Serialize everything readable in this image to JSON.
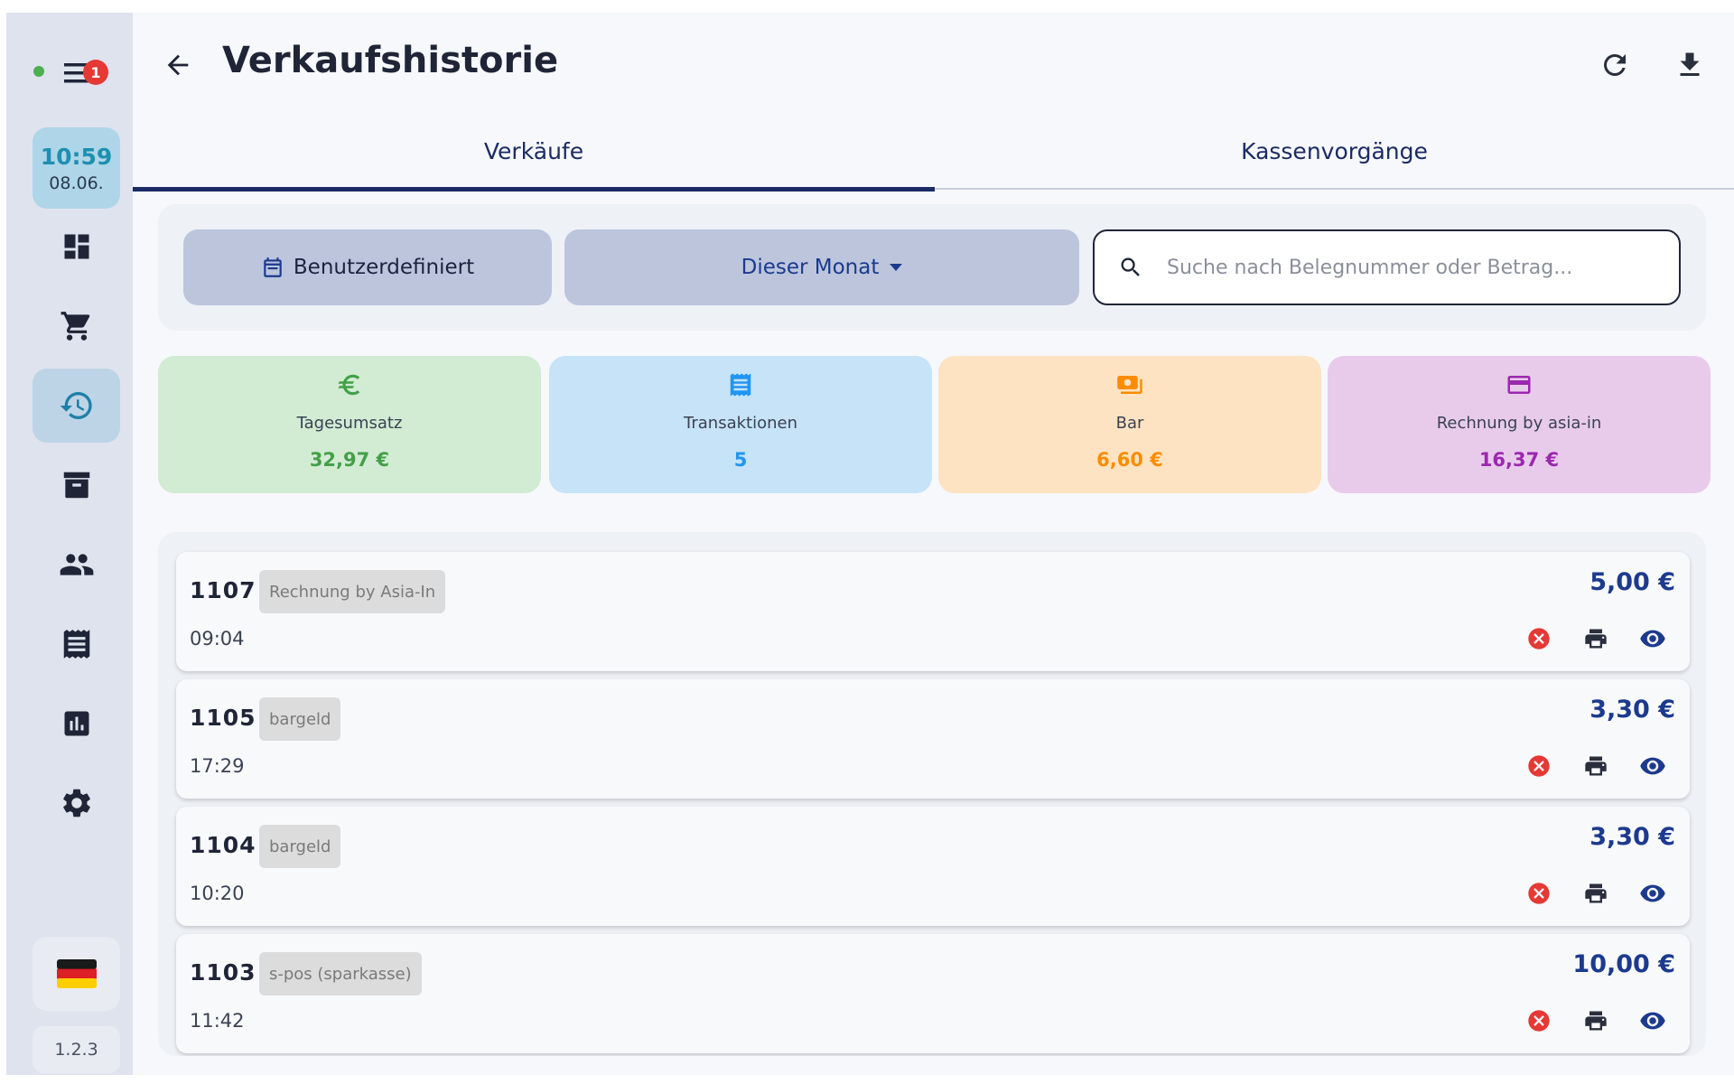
{
  "sidebar": {
    "notification_count": "1",
    "clock": {
      "time": "10:59",
      "date": "08.06."
    },
    "nav_items": [
      {
        "icon": "dashboard-icon"
      },
      {
        "icon": "cart-icon"
      },
      {
        "icon": "history-icon",
        "active": true
      },
      {
        "icon": "archive-icon"
      },
      {
        "icon": "users-icon"
      },
      {
        "icon": "receipt-icon"
      },
      {
        "icon": "chart-icon"
      },
      {
        "icon": "gear-icon"
      }
    ],
    "language_icon": "german-flag-icon",
    "version": "1.2.3"
  },
  "header": {
    "title": "Verkaufshistorie"
  },
  "tabs": [
    {
      "label": "Verkäufe",
      "active": true
    },
    {
      "label": "Kassenvorgänge",
      "active": false
    }
  ],
  "filters": {
    "custom_label": "Benutzerdefiniert",
    "period_label": "Dieser Monat",
    "search_placeholder": "Suche nach Belegnummer oder Betrag..."
  },
  "stats": [
    {
      "label": "Tagesumsatz",
      "value": "32,97 €",
      "color": "#43a047",
      "bg": "#d2ebd3",
      "icon": "euro-icon"
    },
    {
      "label": "Transaktionen",
      "value": "5",
      "color": "#2196f3",
      "bg": "#c6e3f8",
      "icon": "receipt-icon"
    },
    {
      "label": "Bar",
      "value": "6,60 €",
      "color": "#fb8c00",
      "bg": "#fde3c2",
      "icon": "cash-icon"
    },
    {
      "label": "Rechnung by asia-in",
      "value": "16,37 €",
      "color": "#9c27b0",
      "bg": "#e8cbeb",
      "icon": "card-icon"
    }
  ],
  "sales": [
    {
      "number": "1107",
      "method": "Rechnung by Asia-In",
      "time": "09:04",
      "amount": "5,00 €"
    },
    {
      "number": "1105",
      "method": "bargeld",
      "time": "17:29",
      "amount": "3,30 €"
    },
    {
      "number": "1104",
      "method": "bargeld",
      "time": "10:20",
      "amount": "3,30 €"
    },
    {
      "number": "1103",
      "method": "s-pos (sparkasse)",
      "time": "11:42",
      "amount": "10,00 €"
    }
  ],
  "colors": {
    "accent": "#1b2b63",
    "cancel": "#e53935",
    "amount": "#1c3a8e"
  }
}
